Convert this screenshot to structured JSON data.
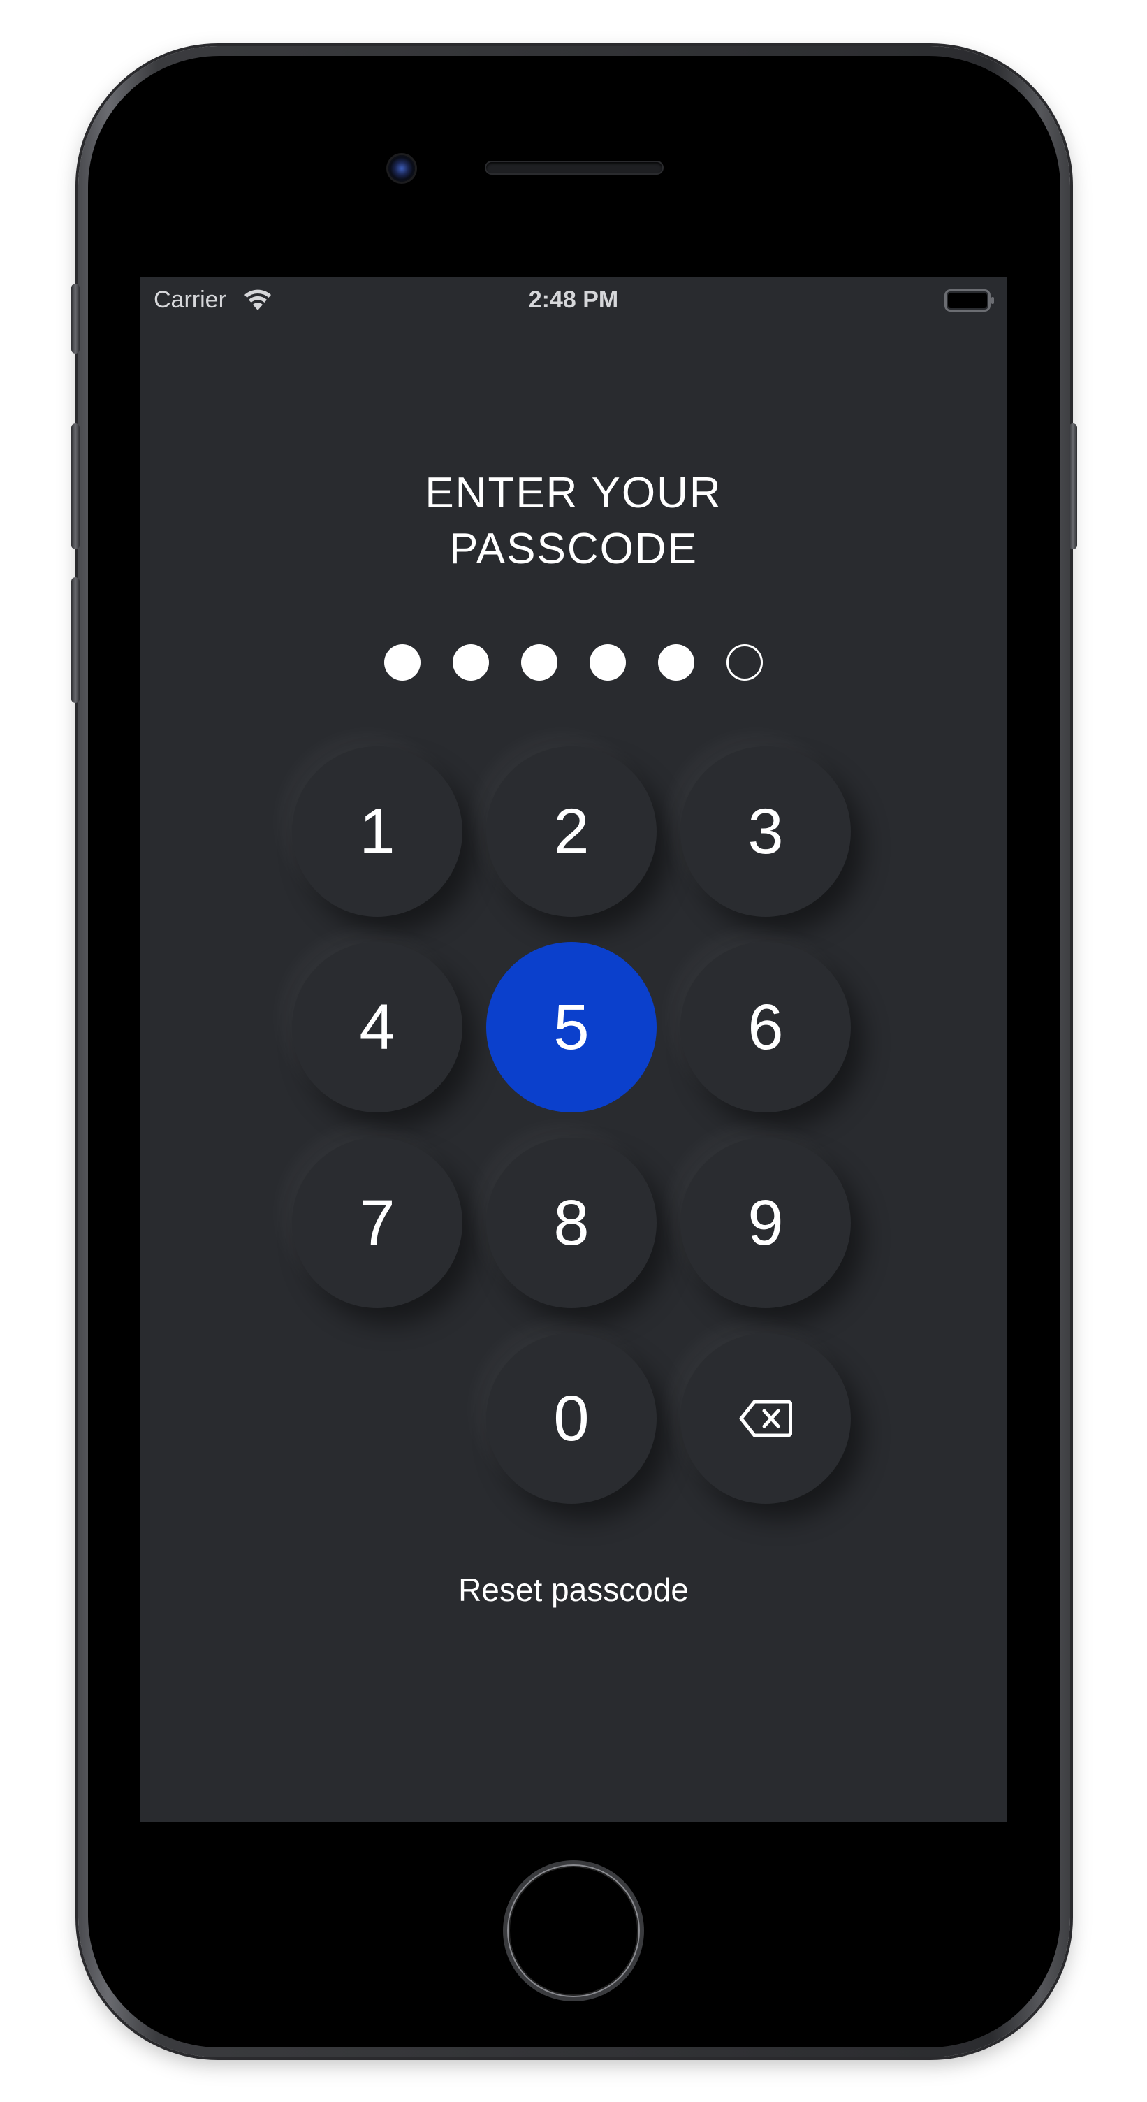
{
  "status_bar": {
    "carrier": "Carrier",
    "time": "2:48 PM",
    "wifi_icon": "wifi-icon",
    "battery_icon": "battery-icon"
  },
  "passcode": {
    "title_line1": "ENTER YOUR",
    "title_line2": "PASSCODE",
    "digits_total": 6,
    "digits_entered": 5
  },
  "keypad": {
    "keys": [
      "1",
      "2",
      "3",
      "4",
      "5",
      "6",
      "7",
      "8",
      "9",
      "0"
    ],
    "active_key": "5",
    "delete_icon": "backspace-icon"
  },
  "reset_label": "Reset passcode",
  "colors": {
    "screen_background": "#292b2f",
    "active_key": "#0b40cc",
    "text": "#ffffff"
  }
}
